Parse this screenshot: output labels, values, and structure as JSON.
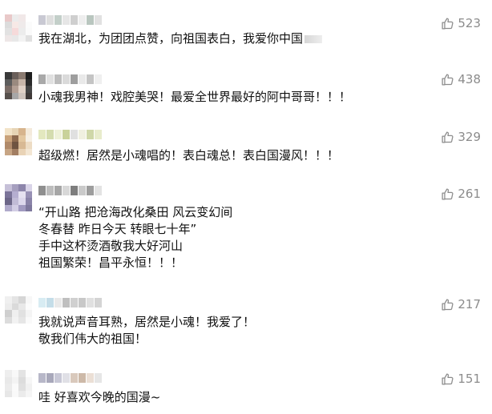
{
  "comments": [
    {
      "likes": "523",
      "lines": [
        "我在湖北，为团团点赞，向祖国表白，我爱你中国"
      ],
      "colors": {
        "avatar": [
          "#e9c9c9",
          "#ececec",
          "#f1e8e8",
          "#ffffff",
          "#dcdcdc",
          "#f7e9e6",
          "#efeaea",
          "#fbfbfb",
          "#e2e2e2",
          "#f6dada",
          "#ececec",
          "#fafafa",
          "#eee7e7",
          "#e8e8e8",
          "#f3f3f3",
          "#e0e0e0"
        ],
        "name": [
          "#c9c9d3",
          "#dedede",
          "#c3cfc9",
          "#e6e6e6",
          "#cfcfcf",
          "#eeeeee",
          "#b9c6bf",
          "#e1e1e1"
        ]
      }
    },
    {
      "likes": "438",
      "lines": [
        "小魂我男神！戏腔美哭！最爱全世界最好的阿中哥哥！！！"
      ],
      "colors": {
        "avatar": [
          "#3a3a3a",
          "#6a5f5a",
          "#8a7a70",
          "#1f1f1f",
          "#5d5d5d",
          "#9a8a7f",
          "#c8b6a9",
          "#2b2b2b",
          "#7a6c66",
          "#b39f94",
          "#e0d1c6",
          "#444444",
          "#57504c",
          "#a7a7a7",
          "#cfc4bd",
          "#3f3a38"
        ],
        "name": [
          "#a9a9a9",
          "#e0e0e0",
          "#bdbdbd",
          "#dadada",
          "#9e9e9e",
          "#e9e9e9",
          "#c4c4c4",
          "#efefef"
        ]
      }
    },
    {
      "likes": "329",
      "lines": [
        "超级燃！居然是小魂唱的！表白魂总！表白国漫风！！！"
      ],
      "colors": {
        "avatar": [
          "#f2e3c8",
          "#e6d4b5",
          "#d7b48d",
          "#f4eadb",
          "#c9a27a",
          "#8d6a4f",
          "#e3c7a0",
          "#f6efe4",
          "#b08a6a",
          "#6f5441",
          "#d8b994",
          "#eddcc4",
          "#c7a584",
          "#a27e62",
          "#e9d3b6",
          "#f3e6d3"
        ],
        "name": [
          "#e3e8bf",
          "#d4dcae",
          "#eef1d8",
          "#c9d29a",
          "#e0e0e0",
          "#f0f0e0",
          "#cfd7a8",
          "#e8eccc"
        ]
      }
    },
    {
      "likes": "261",
      "lines": [
        "“开山路 把沧海改化桑田 风云变幻间",
        "冬春替 昨日今天 转眼七十年”",
        "手中这杯烫酒敬我大好河山",
        "祖国繁荣！昌平永恒！！！"
      ],
      "colors": {
        "avatar": [
          "#c6c0d8",
          "#a69fbf",
          "#8d86ab",
          "#d9d4e8",
          "#7b7499",
          "#b5aed0",
          "#e5e1f0",
          "#9891b5",
          "#6c6688",
          "#c1bbd6",
          "#ddd8ec",
          "#8a83a8",
          "#b0aacb",
          "#d2cde4",
          "#a19ac0",
          "#7e789d"
        ],
        "name": [
          "#8f8f8f",
          "#bdbdbd",
          "#a6a6a6",
          "#d8d8d8",
          "#7e7e7e",
          "#cacaca",
          "#9d9d9d",
          "#e3e3e3"
        ]
      }
    },
    {
      "likes": "217",
      "lines": [
        "我就说声音耳熟，居然是小魂！我爱了！",
        "敬我们伟大的祖国！"
      ],
      "colors": {
        "avatar": [
          "#f0f0f0",
          "#e4e4e4",
          "#d6d6d6",
          "#f7f7f7",
          "#ececec",
          "#dadada",
          "#e8e8e8",
          "#fbfbfb",
          "#cfcfcf",
          "#efefef",
          "#e1e1e1",
          "#f4f4f4",
          "#dcdcdc",
          "#f2f2f2",
          "#e6e6e6",
          "#fafafa"
        ],
        "name": [
          "#d8ecf3",
          "#c4dde8",
          "#e9e9e9",
          "#bfbfbf",
          "#d0d0d0",
          "#c8c8c8",
          "#e0e0e0",
          "#d4d4d4"
        ]
      }
    },
    {
      "likes": "151",
      "lines": [
        "哇 好喜欢今晚的国漫~"
      ],
      "colors": {
        "avatar": [
          "#eeeeee",
          "#f8f8f8",
          "#e3e3e3",
          "#fdfdfd",
          "#e9e9e9",
          "#f3f3f3",
          "#dcdcdc",
          "#f6f6f6",
          "#ececec",
          "#fafafa",
          "#e0e0e0",
          "#f1f1f1",
          "#e7e7e7",
          "#f9f9f9",
          "#ebebeb",
          "#f5f5f5"
        ],
        "name": [
          "#b7b7c8",
          "#a8a8ba",
          "#c8c8d6",
          "#e0e0e6",
          "#d9c9bc",
          "#cdb9a8",
          "#ebdfd5",
          "#e6e6e6"
        ]
      }
    }
  ]
}
